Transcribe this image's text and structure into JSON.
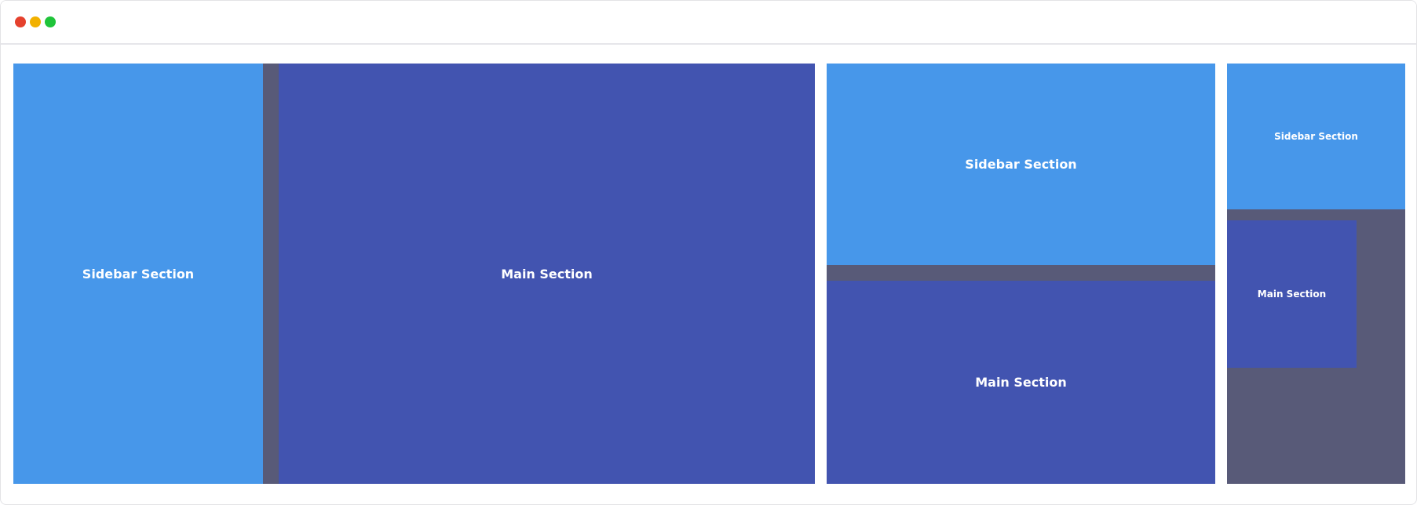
{
  "window": {
    "controls": {
      "close_color": "#e5412d",
      "minimize_color": "#f2b100",
      "maximize_color": "#1fc43a"
    }
  },
  "colors": {
    "sidebar": "#4797ea",
    "main": "#4254b0",
    "gap": "#585a78"
  },
  "layouts": [
    {
      "sidebar_label": "Sidebar Section",
      "main_label": "Main Section"
    },
    {
      "sidebar_label": "Sidebar Section",
      "main_label": "Main Section"
    },
    {
      "sidebar_label": "Sidebar Section",
      "main_label": "Main Section"
    }
  ]
}
